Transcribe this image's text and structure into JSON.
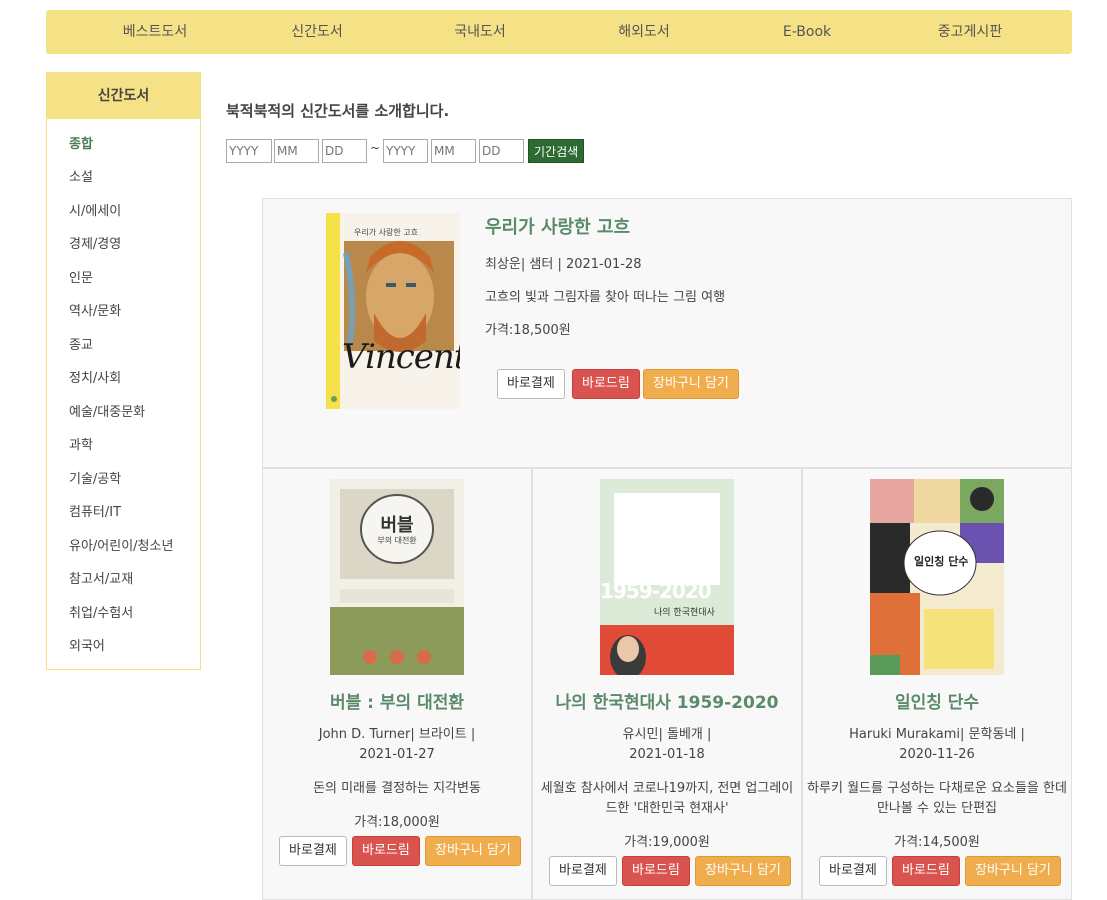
{
  "nav": {
    "items": [
      "베스트도서",
      "신간도서",
      "국내도서",
      "해외도서",
      "E-Book",
      "중고게시판"
    ]
  },
  "sidebar": {
    "title": "신간도서",
    "items": [
      "종합",
      "소설",
      "시/에세이",
      "경제/경영",
      "인문",
      "역사/문화",
      "종교",
      "정치/사회",
      "예술/대중문화",
      "과학",
      "기술/공학",
      "컴퓨터/IT",
      "유아/어린이/청소년",
      "참고서/교재",
      "취업/수험서",
      "외국어"
    ],
    "active_index": 0
  },
  "main": {
    "intro": "북적북적의 신간도서를 소개합니다.",
    "search": {
      "from_year_ph": "YYYY",
      "from_month_ph": "MM",
      "from_day_ph": "DD",
      "tilde": "~",
      "to_year_ph": "YYYY",
      "to_month_ph": "MM",
      "to_day_ph": "DD",
      "button": "기간검색"
    }
  },
  "featured": {
    "title": "우리가 사랑한 고흐",
    "meta": "최상운| 샘터 | 2021-01-28",
    "desc": "고흐의 빛과 그림자를 찾아 떠나는 그림 여행",
    "price": "가격:18,500원",
    "cover_text": "우리가 사랑한 고흐",
    "cover_script": "Vincent"
  },
  "buttons": {
    "buy": "바로결제",
    "gift": "바로드림",
    "cart": "장바구니 담기"
  },
  "books": [
    {
      "title": "버블 : 부의 대전환",
      "author": "John D. Turner| 브라이트 |",
      "date": "2021-01-27",
      "desc": "돈의 미래를 결정하는 지각변동",
      "price": "가격:18,000원",
      "cover_text": "버블",
      "cover_sub": "부의 대전환"
    },
    {
      "title": "나의 한국현대사 1959-2020",
      "author": "유시민| 돌베개 |",
      "date": "2021-01-18",
      "desc": "세월호 참사에서 코로나19까지, 전면 업그레이드한 '대한민국 현재사'",
      "price": "가격:19,000원",
      "cover_text": "1959-2020",
      "cover_sub": "나의 한국현대사"
    },
    {
      "title": "일인칭 단수",
      "author": "Haruki Murakami| 문학동네 |",
      "date": "2020-11-26",
      "desc": "하루키 월드를 구성하는 다채로운 요소들을 한데 만나볼 수 있는 단편집",
      "price": "가격:14,500원",
      "cover_text": "일인칭 단수"
    }
  ]
}
